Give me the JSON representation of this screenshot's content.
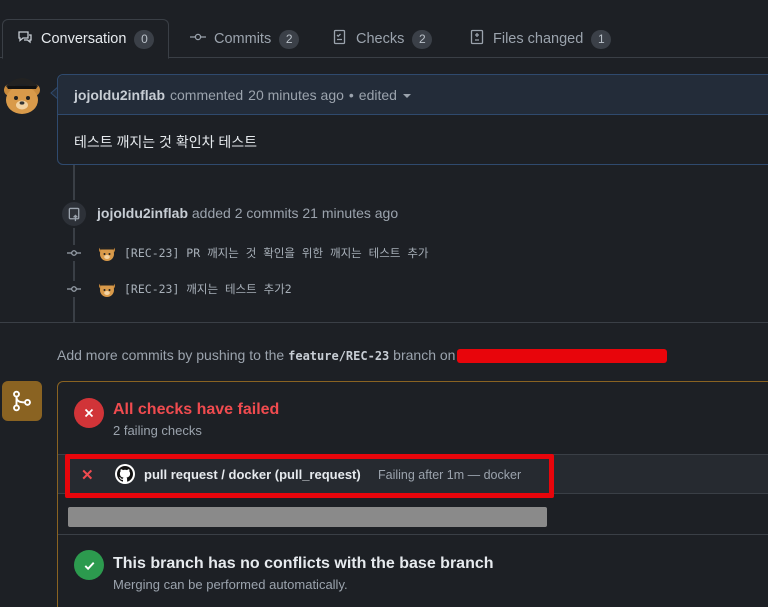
{
  "tabs": [
    {
      "label": "Conversation",
      "count": "0",
      "icon": "conversation-icon"
    },
    {
      "label": "Commits",
      "count": "2",
      "icon": "commit-icon"
    },
    {
      "label": "Checks",
      "count": "2",
      "icon": "checklist-icon"
    },
    {
      "label": "Files changed",
      "count": "1",
      "icon": "file-diff-icon"
    }
  ],
  "comment": {
    "author": "jojoldu2inflab",
    "action": "commented",
    "time": "20 minutes ago",
    "separator": "•",
    "edited": "edited",
    "body": "테스트 깨지는 것 확인차 테스트"
  },
  "push_event": {
    "author": "jojoldu2inflab",
    "text": "added 2 commits 21 minutes ago"
  },
  "commits": [
    {
      "message": "[REC-23] PR 깨지는 것 확인을 위한 깨지는 테스트 추가"
    },
    {
      "message": "[REC-23] 깨지는 테스트 추가2"
    }
  ],
  "hint": {
    "prefix": "Add more commits by pushing to the",
    "branch": "feature/REC-23",
    "suffix": "branch on"
  },
  "checks": {
    "title": "All checks have failed",
    "subtitle": "2 failing checks",
    "items": [
      {
        "name": "pull request / docker (pull_request)",
        "status": "Failing after 1m — docker"
      }
    ]
  },
  "merge": {
    "title": "This branch has no conflicts with the base branch",
    "subtitle": "Merging can be performed automatically."
  },
  "colors": {
    "failure": "#f04b4f",
    "success": "#2c9a4e",
    "redaction": "#e8050b",
    "merge_border": "#8a6322"
  }
}
